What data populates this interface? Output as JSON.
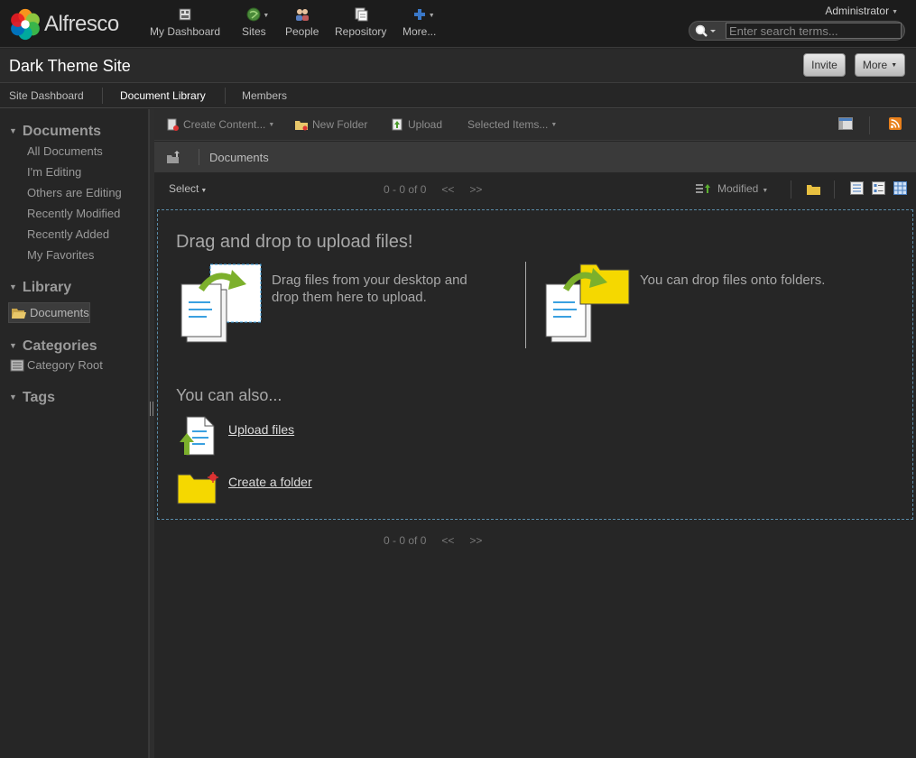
{
  "header": {
    "logo_text": "Alfresco",
    "nav": [
      {
        "label": "My Dashboard",
        "icon": "dashboard-icon"
      },
      {
        "label": "Sites",
        "icon": "globe-icon"
      },
      {
        "label": "People",
        "icon": "people-icon"
      },
      {
        "label": "Repository",
        "icon": "repository-icon"
      },
      {
        "label": "More...",
        "icon": "plus-icon"
      }
    ],
    "user": "Administrator",
    "search_placeholder": "Enter search terms..."
  },
  "site": {
    "title": "Dark Theme Site",
    "invite_label": "Invite",
    "more_label": "More"
  },
  "site_nav": [
    {
      "label": "Site Dashboard"
    },
    {
      "label": "Document Library"
    },
    {
      "label": "Members"
    }
  ],
  "sidebar": {
    "documents_heading": "Documents",
    "document_filters": [
      "All Documents",
      "I'm Editing",
      "Others are Editing",
      "Recently Modified",
      "Recently Added",
      "My Favorites"
    ],
    "library_heading": "Library",
    "library_item": "Documents",
    "categories_heading": "Categories",
    "category_root": "Category Root",
    "tags_heading": "Tags"
  },
  "toolbar": {
    "create_content": "Create Content...",
    "new_folder": "New Folder",
    "upload": "Upload",
    "selected_items": "Selected Items..."
  },
  "path": {
    "crumb": "Documents"
  },
  "list": {
    "select_label": "Select",
    "pager_text": "0 - 0 of 0",
    "prev": "<<",
    "next": ">>",
    "sort_label": "Modified"
  },
  "dropzone": {
    "title": "Drag and drop to upload files!",
    "desktop_text": "Drag files from your desktop and drop them here to upload.",
    "folders_text": "You can drop files onto folders.",
    "also_title": "You can also...",
    "upload_link": "Upload files",
    "folder_link": "Create a folder"
  },
  "colors": {
    "background": "#262626",
    "dropzone_border": "#5a8ca8",
    "folder_yellow": "#f5d800",
    "arrow_green": "#7cb02c"
  }
}
